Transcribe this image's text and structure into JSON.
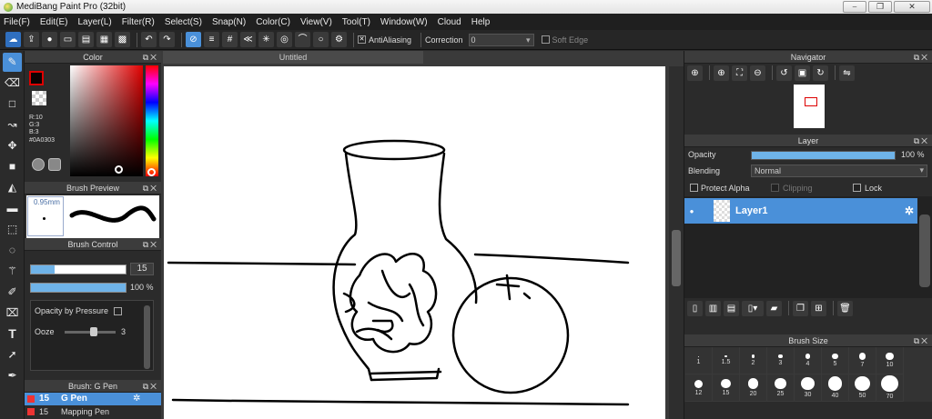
{
  "window": {
    "title": "MediBang Paint Pro (32bit)",
    "btn_min": "⎯",
    "btn_max": "❐",
    "btn_close": "✕"
  },
  "menu": [
    "File(F)",
    "Edit(E)",
    "Layer(L)",
    "Filter(R)",
    "Select(S)",
    "Snap(N)",
    "Color(C)",
    "View(V)",
    "Tool(T)",
    "Window(W)",
    "Cloud",
    "Help"
  ],
  "toolbar": {
    "antialiasing_label": "AntiAliasing",
    "correction_label": "Correction",
    "correction_value": "0",
    "soft_edge_label": "Soft Edge",
    "icons": [
      "cloud-icon",
      "share-icon",
      "chat-icon",
      "comment-icon",
      "page-icon",
      "manage-icon",
      "grid-icon",
      "undo-icon",
      "redo-icon",
      "snap-off-icon",
      "snap-parallel-icon",
      "snap-grid-icon",
      "snap-radial-icon",
      "snap-vanish-icon",
      "snap-concentric-icon",
      "snap-curve-icon",
      "snap-circle-icon",
      "snap-settings-icon"
    ],
    "accent": "#4a90d9"
  },
  "tools": [
    "brush-icon",
    "eraser-icon",
    "rectangle-icon",
    "pen-move-icon",
    "move-icon",
    "fill-rect-icon",
    "bucket-icon",
    "gradient-icon",
    "select-rect-icon",
    "lasso-icon",
    "magic-wand-icon",
    "select-pen-icon",
    "select-eraser-icon",
    "text-icon",
    "operation-icon",
    "eyedropper-icon"
  ],
  "color_panel": {
    "title": "Color",
    "r": "R:10",
    "g": "G:3",
    "b": "B:3",
    "hex": "#0A0303",
    "current_color": "#0a0303"
  },
  "brush_preview": {
    "title": "Brush Preview",
    "size": "0.95mm"
  },
  "brush_control": {
    "title": "Brush Control",
    "size_value": "15",
    "size_fill": 0.25,
    "opacity_value": "100 %",
    "opacity_fill": 1.0,
    "opacity_by_pressure": "Opacity by Pressure",
    "ooze_label": "Ooze",
    "ooze_value": "3"
  },
  "brush_list": {
    "title": "Brush: G Pen",
    "items": [
      {
        "size": "15",
        "name": "G Pen"
      },
      {
        "size": "15",
        "name": "Mapping Pen"
      }
    ]
  },
  "document": {
    "tab": "Untitled"
  },
  "navigator": {
    "title": "Navigator"
  },
  "layer_panel": {
    "title": "Layer",
    "opacity_label": "Opacity",
    "opacity_value": "100 %",
    "opacity_fill": 1.0,
    "blending_label": "Blending",
    "blending_value": "Normal",
    "protect_alpha": "Protect Alpha",
    "clipping": "Clipping",
    "lock": "Lock",
    "layer_name": "Layer1"
  },
  "brush_size": {
    "title": "Brush Size",
    "row1": [
      "1",
      "1.5",
      "2",
      "3",
      "4",
      "5",
      "7",
      "10"
    ],
    "row2": [
      "12",
      "15",
      "20",
      "25",
      "30",
      "40",
      "50",
      "70"
    ]
  }
}
